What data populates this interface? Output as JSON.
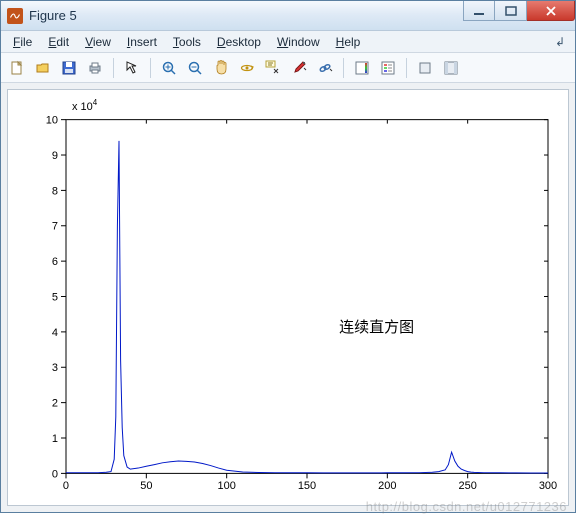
{
  "window": {
    "title": "Figure 5"
  },
  "menu": {
    "file": "File",
    "edit": "Edit",
    "view": "View",
    "insert": "Insert",
    "tools": "Tools",
    "desktop": "Desktop",
    "window": "Window",
    "help": "Help"
  },
  "toolbar_tooltips": {
    "new": "New Figure",
    "open": "Open File",
    "save": "Save Figure",
    "print": "Print Figure",
    "edit_plot": "Edit Plot",
    "zoom_in": "Zoom In",
    "zoom_out": "Zoom Out",
    "pan": "Pan",
    "rotate": "Rotate 3D",
    "data_cursor": "Data Cursor",
    "brush": "Brush",
    "link": "Link Plot",
    "colorbar": "Insert Colorbar",
    "legend": "Insert Legend",
    "hide_tools": "Hide Plot Tools",
    "show_tools": "Show Plot Tools"
  },
  "chart_data": {
    "type": "line",
    "title": "",
    "multiplier_label": "x 10",
    "multiplier_exp": "4",
    "annotation": "连续直方图",
    "xlabel": "",
    "ylabel": "",
    "xlim": [
      0,
      300
    ],
    "ylim": [
      0,
      10
    ],
    "xticks": [
      0,
      50,
      100,
      150,
      200,
      250,
      300
    ],
    "yticks": [
      0,
      1,
      2,
      3,
      4,
      5,
      6,
      7,
      8,
      9,
      10
    ],
    "x": [
      0,
      10,
      20,
      25,
      28,
      30,
      31,
      32,
      33,
      34,
      35,
      36,
      38,
      40,
      45,
      50,
      55,
      60,
      65,
      70,
      75,
      80,
      85,
      90,
      95,
      100,
      110,
      120,
      130,
      140,
      150,
      160,
      170,
      180,
      190,
      200,
      210,
      220,
      228,
      232,
      236,
      238,
      240,
      242,
      244,
      246,
      248,
      250,
      252,
      254,
      260,
      270,
      280,
      290,
      300
    ],
    "y": [
      0.02,
      0.02,
      0.02,
      0.03,
      0.05,
      0.4,
      1.6,
      7.0,
      9.4,
      3.2,
      1.3,
      0.5,
      0.18,
      0.12,
      0.15,
      0.2,
      0.25,
      0.3,
      0.33,
      0.35,
      0.34,
      0.32,
      0.28,
      0.22,
      0.15,
      0.09,
      0.04,
      0.025,
      0.02,
      0.018,
      0.016,
      0.015,
      0.015,
      0.015,
      0.015,
      0.016,
      0.018,
      0.02,
      0.03,
      0.05,
      0.1,
      0.25,
      0.6,
      0.35,
      0.2,
      0.12,
      0.08,
      0.05,
      0.035,
      0.028,
      0.02,
      0.016,
      0.014,
      0.012,
      0.012
    ]
  },
  "watermark": "http://blog.csdn.net/u012771236"
}
